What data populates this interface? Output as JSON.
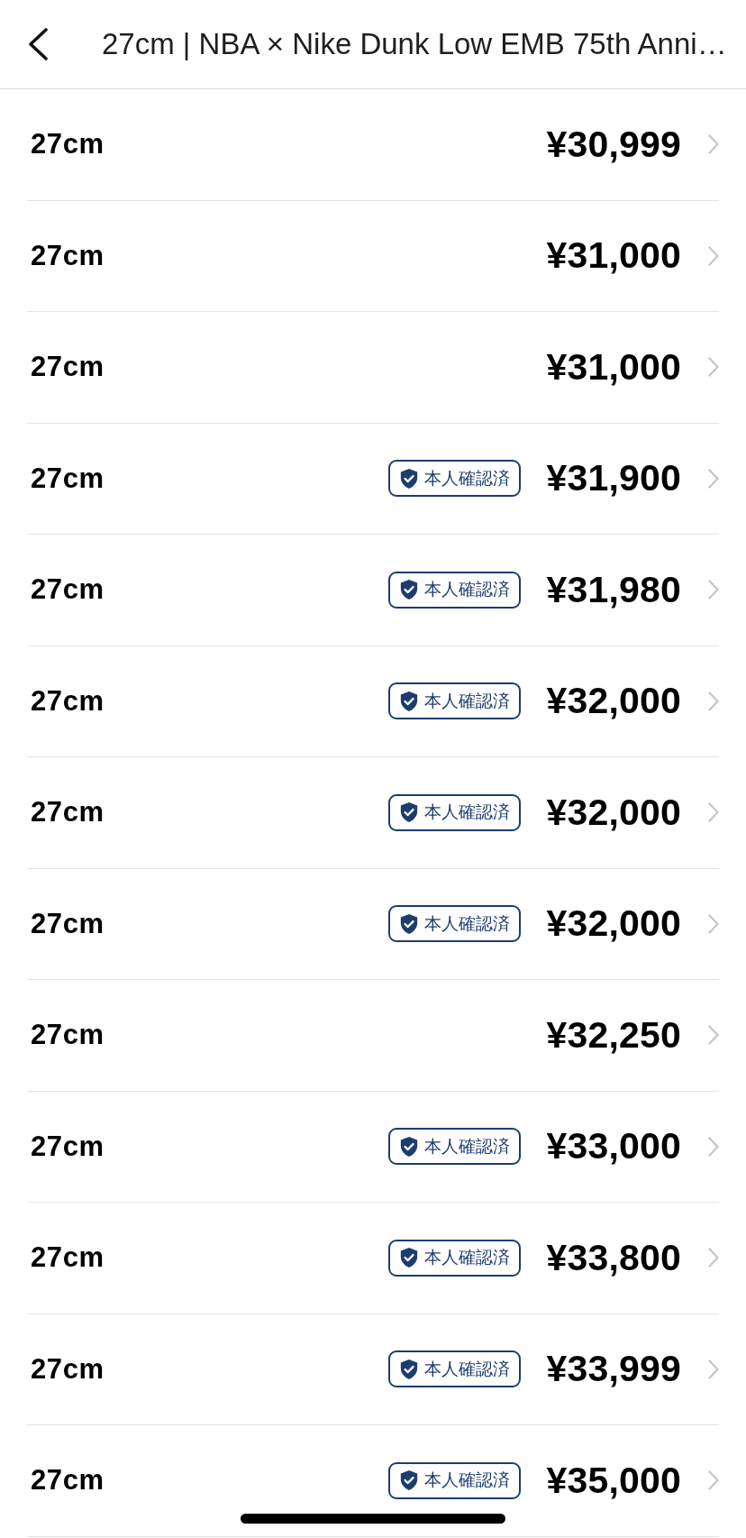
{
  "header": {
    "title": "27cm | NBA × Nike Dunk Low EMB 75th Anni…"
  },
  "listings": [
    {
      "size": "27cm",
      "price": "¥30,999"
    },
    {
      "size": "27cm",
      "price": "¥31,000"
    },
    {
      "size": "27cm",
      "price": "¥31,000"
    },
    {
      "size": "27cm",
      "badge": "本人確認済",
      "price": "¥31,900"
    },
    {
      "size": "27cm",
      "badge": "本人確認済",
      "price": "¥31,980"
    },
    {
      "size": "27cm",
      "badge": "本人確認済",
      "price": "¥32,000"
    },
    {
      "size": "27cm",
      "badge": "本人確認済",
      "price": "¥32,000"
    },
    {
      "size": "27cm",
      "badge": "本人確認済",
      "price": "¥32,000"
    },
    {
      "size": "27cm",
      "price": "¥32,250"
    },
    {
      "size": "27cm",
      "badge": "本人確認済",
      "price": "¥33,000"
    },
    {
      "size": "27cm",
      "badge": "本人確認済",
      "price": "¥33,800"
    },
    {
      "size": "27cm",
      "badge": "本人確認済",
      "price": "¥33,999"
    },
    {
      "size": "27cm",
      "badge": "本人確認済",
      "price": "¥35,000"
    }
  ]
}
